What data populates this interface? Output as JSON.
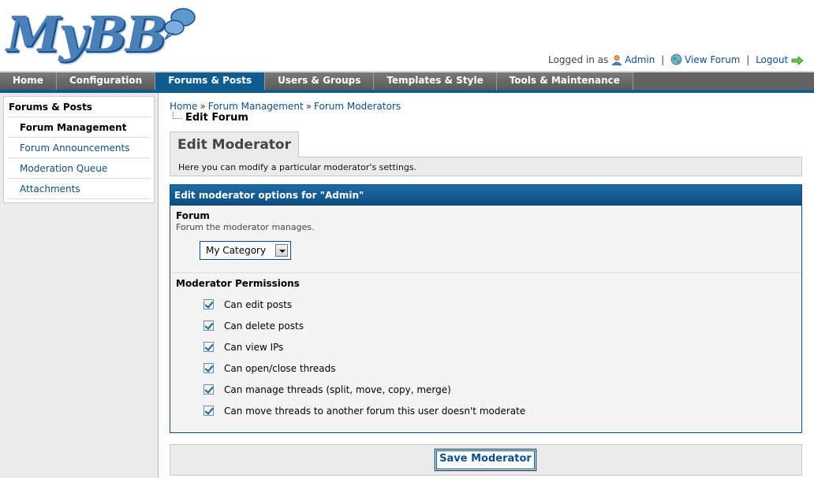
{
  "brand": {
    "logo_text": "MyBB"
  },
  "userbar": {
    "logged_in_as": "Logged in as",
    "username": "Admin",
    "view_forum": "View Forum",
    "logout": "Logout",
    "separator": "|"
  },
  "menu": {
    "tabs": [
      {
        "label": "Home"
      },
      {
        "label": "Configuration"
      },
      {
        "label": "Forums & Posts"
      },
      {
        "label": "Users & Groups"
      },
      {
        "label": "Templates & Style"
      },
      {
        "label": "Tools & Maintenance"
      }
    ],
    "active": "Forums & Posts"
  },
  "sidebar": {
    "title": "Forums & Posts",
    "items": [
      {
        "label": "Forum Management"
      },
      {
        "label": "Forum Announcements"
      },
      {
        "label": "Moderation Queue"
      },
      {
        "label": "Attachments"
      }
    ]
  },
  "breadcrumb": {
    "items": [
      "Home",
      "Forum Management",
      "Forum Moderators"
    ],
    "separator": "»",
    "current": "Edit Forum"
  },
  "page": {
    "title": "Edit Moderator",
    "description": "Here you can modify a particular moderator's settings."
  },
  "form": {
    "header": "Edit moderator options for \"Admin\"",
    "forum": {
      "label": "Forum",
      "hint": "Forum the moderator manages.",
      "selected": "My Category"
    },
    "permissions": {
      "label": "Moderator Permissions",
      "items": [
        {
          "label": "Can edit posts",
          "checked": true
        },
        {
          "label": "Can delete posts",
          "checked": true
        },
        {
          "label": "Can view IPs",
          "checked": true
        },
        {
          "label": "Can open/close threads",
          "checked": true
        },
        {
          "label": "Can manage threads (split, move, copy, merge)",
          "checked": true
        },
        {
          "label": "Can move threads to another forum this user doesn't moderate",
          "checked": true
        }
      ]
    },
    "submit_label": "Save Moderator"
  },
  "colors": {
    "accent": "#0f5c8e",
    "menu_bg": "#636363",
    "link": "#0e4d8b"
  }
}
